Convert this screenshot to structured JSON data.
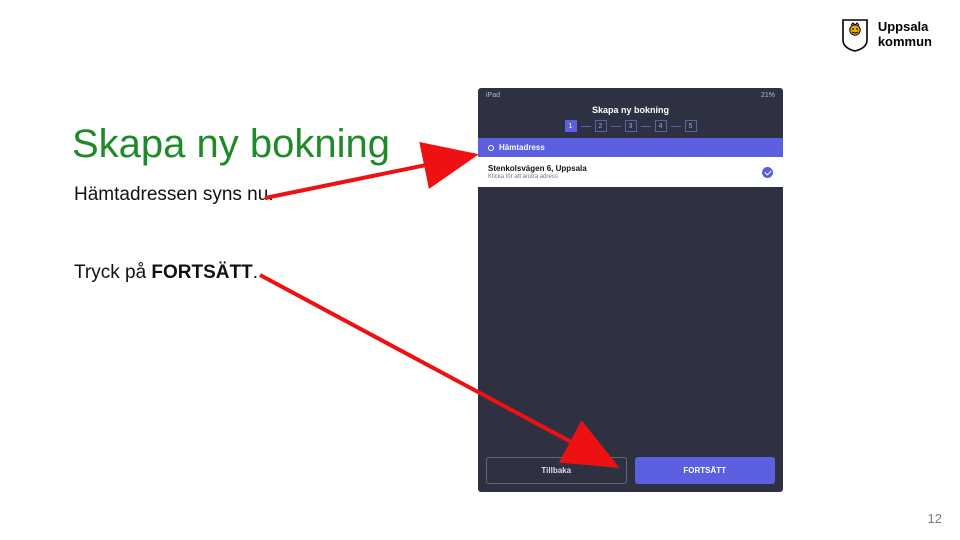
{
  "logo": {
    "line1": "Uppsala",
    "line2": "kommun"
  },
  "slide": {
    "title": "Skapa ny bokning",
    "line1": "Hämtadressen syns nu.",
    "line2_prefix": "Tryck på ",
    "line2_bold": "FORTSÄTT",
    "line2_suffix": "."
  },
  "page_number": "12",
  "phone": {
    "status_left": "iPad",
    "status_right": "21%",
    "app_title": "Skapa ny bokning",
    "steps": [
      "1",
      "2",
      "3",
      "4",
      "5"
    ],
    "section_label": "Hämtadress",
    "address_main": "Stenkolsvägen 6, Uppsala",
    "address_sub": "Klicka för att ändra adress",
    "btn_back": "Tillbaka",
    "btn_continue": "FORTSÄTT"
  }
}
